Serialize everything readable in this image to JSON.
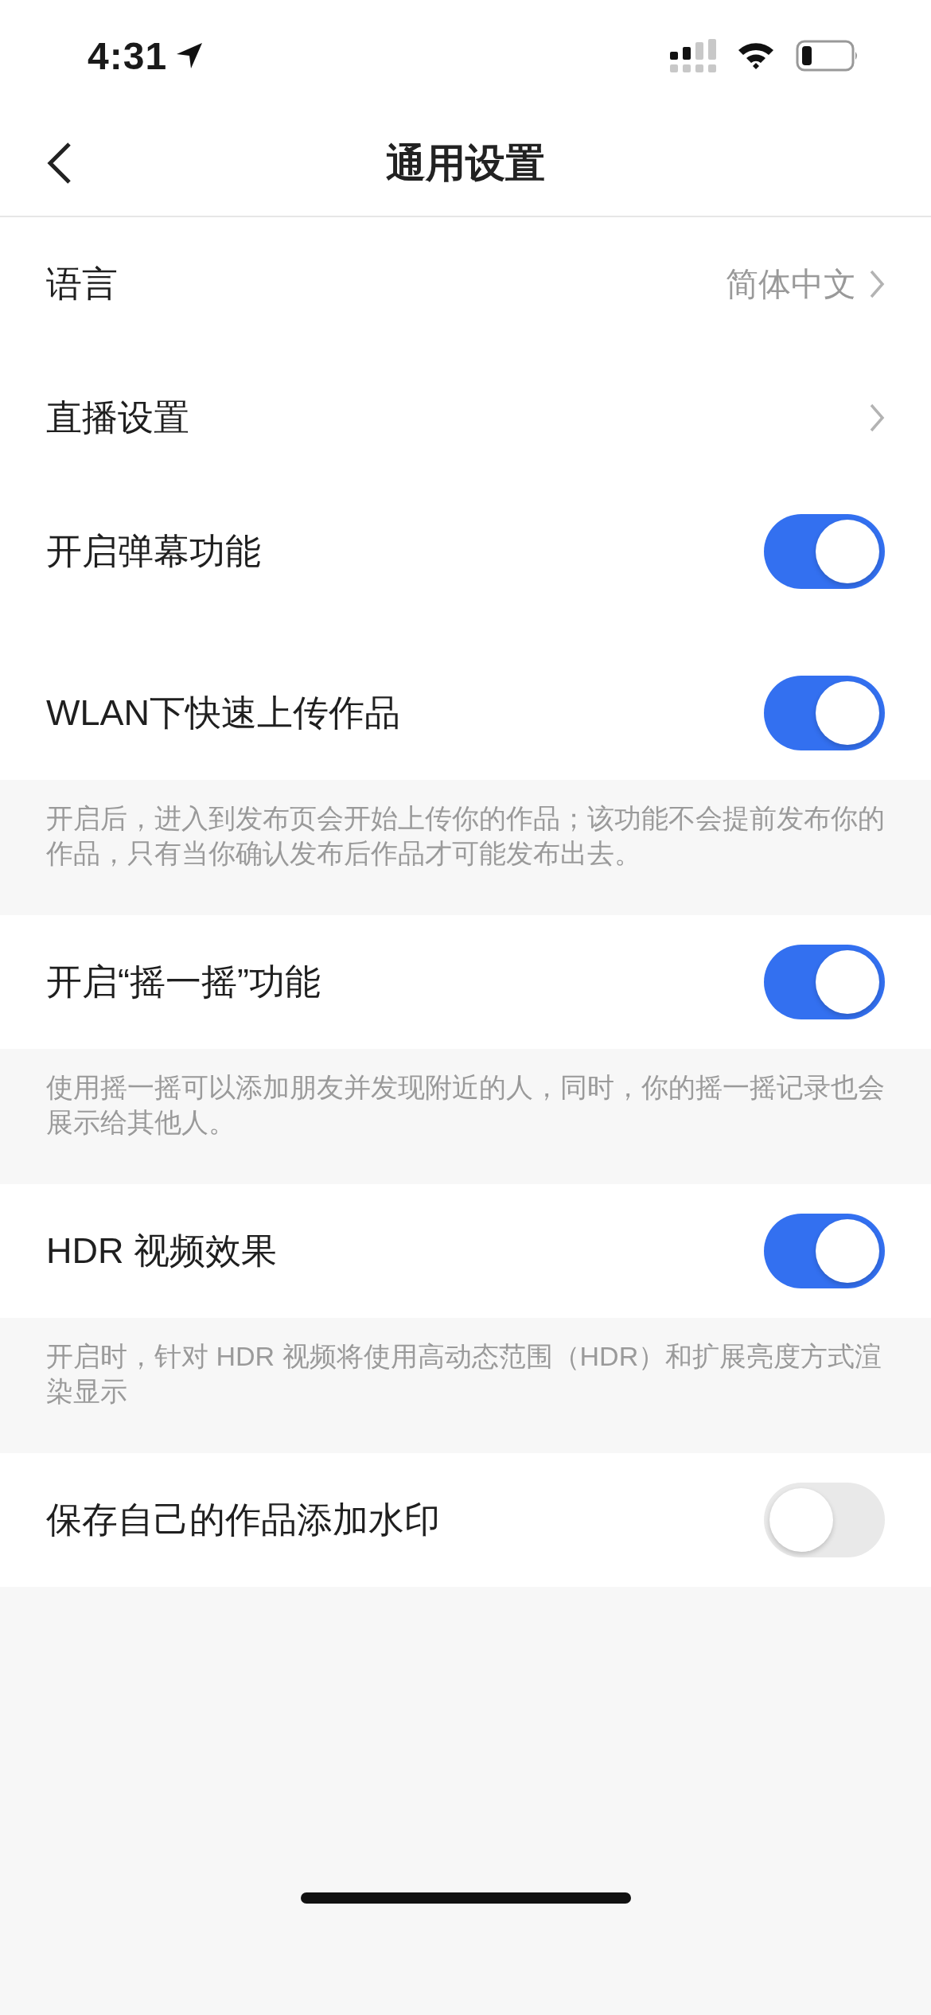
{
  "status_bar": {
    "time": "4:31"
  },
  "nav": {
    "title": "通用设置"
  },
  "settings": [
    {
      "kind": "link",
      "label": "语言",
      "value": "简体中文"
    },
    {
      "kind": "link",
      "label": "直播设置"
    },
    {
      "kind": "toggle",
      "label": "开启弹幕功能",
      "on": true
    },
    {
      "kind": "toggle",
      "label": "WLAN下快速上传作品",
      "on": true
    },
    {
      "kind": "note",
      "text": "开启后，进入到发布页会开始上传你的作品；该功能不会提前发布你的作品，只有当你确认发布后作品才可能发布出去。"
    },
    {
      "kind": "toggle",
      "label": "开启“摇一摇”功能",
      "on": true
    },
    {
      "kind": "note",
      "text": "使用摇一摇可以添加朋友并发现附近的人，同时，你的摇一摇记录也会展示给其他人。"
    },
    {
      "kind": "toggle",
      "label": "HDR 视频效果",
      "on": true
    },
    {
      "kind": "note",
      "text": "开启时，针对 HDR 视频将使用高动态范围（HDR）和扩展亮度方式渲染显示"
    },
    {
      "kind": "toggle",
      "label": "保存自己的作品添加水印",
      "on": false
    }
  ]
}
